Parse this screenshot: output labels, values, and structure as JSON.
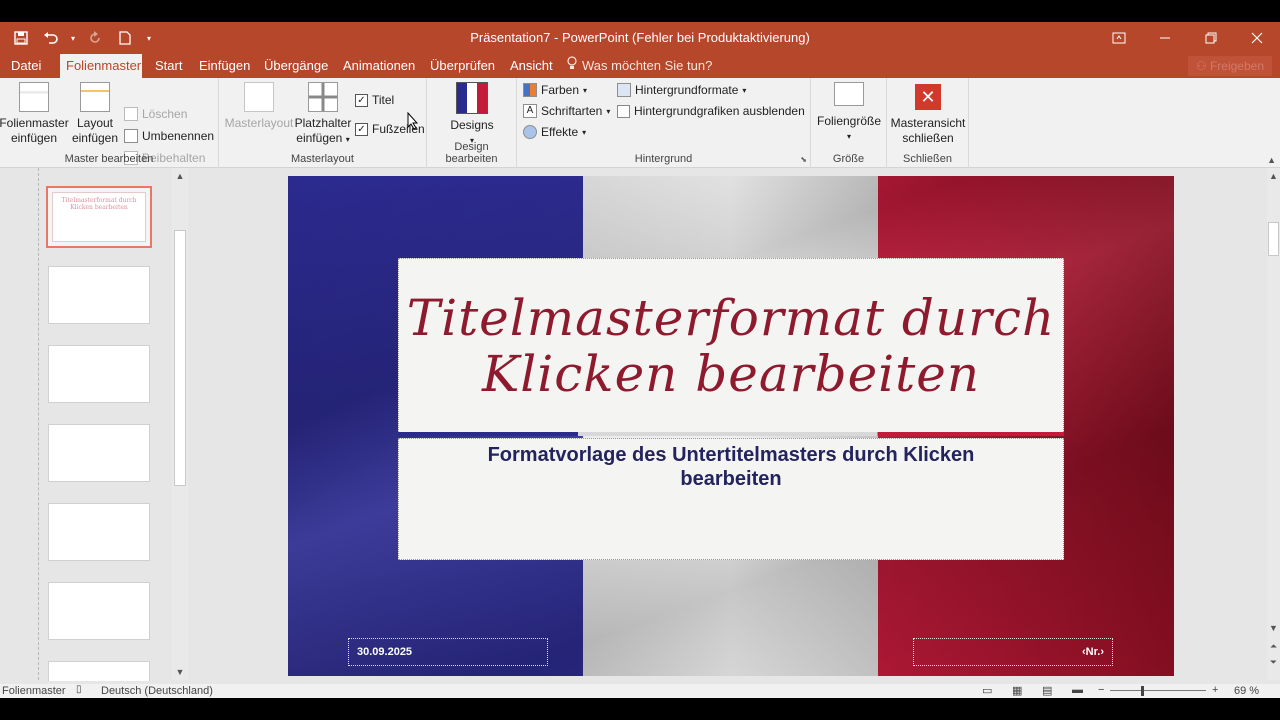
{
  "window": {
    "title": "Präsentation7 - PowerPoint (Fehler bei Produktaktivierung)",
    "controls": [
      "ribbon-display-options",
      "minimize",
      "restore",
      "close"
    ]
  },
  "tabs": [
    {
      "label": "Datei",
      "active": false
    },
    {
      "label": "Folienmaster",
      "active": true
    },
    {
      "label": "Start",
      "active": false
    },
    {
      "label": "Einfügen",
      "active": false
    },
    {
      "label": "Übergänge",
      "active": false
    },
    {
      "label": "Animationen",
      "active": false
    },
    {
      "label": "Überprüfen",
      "active": false
    },
    {
      "label": "Ansicht",
      "active": false
    }
  ],
  "tellme": "Was möchten Sie tun?",
  "share": "Freigeben",
  "ribbon": {
    "master_edit": {
      "label": "Master bearbeiten",
      "insert_master_1": "Folienmaster",
      "insert_master_2": "einfügen",
      "insert_layout_1": "Layout",
      "insert_layout_2": "einfügen",
      "delete": "Löschen",
      "rename": "Umbenennen",
      "preserve": "Beibehalten"
    },
    "master_layout": {
      "label": "Masterlayout",
      "masterlayout": "Masterlayout",
      "placeholder_1": "Platzhalter",
      "placeholder_2": "einfügen",
      "title_check": "Titel",
      "footer_check": "Fußzeilen"
    },
    "design_edit": {
      "label": "Design bearbeiten",
      "designs": "Designs"
    },
    "background": {
      "label": "Hintergrund",
      "colors": "Farben",
      "fonts": "Schriftarten",
      "effects": "Effekte",
      "bg_styles": "Hintergrundformate",
      "hide_bg": "Hintergrundgrafiken ausblenden"
    },
    "size": {
      "label": "Größe",
      "slide_size": "Foliengröße"
    },
    "close": {
      "label": "Schließen",
      "close_1": "Masteransicht",
      "close_2": "schließen"
    }
  },
  "slide": {
    "title_line1": "Titelmasterformat durch",
    "title_line2": "Klicken bearbeiten",
    "subtitle_line1": "Formatvorlage des Untertitelmasters durch Klicken",
    "subtitle_line2": "bearbeiten",
    "date": "30.09.2025",
    "number": "‹Nr.›"
  },
  "thumbnail": {
    "line1": "Titelmasterformat durch",
    "line2": "Klicken bearbeiten"
  },
  "status": {
    "view": "Folienmaster",
    "language": "Deutsch (Deutschland)",
    "zoom": "69 %"
  },
  "colors": {
    "accent": "#b7472a",
    "title_red": "#8e1a2e",
    "subtitle_navy": "#23235f"
  }
}
